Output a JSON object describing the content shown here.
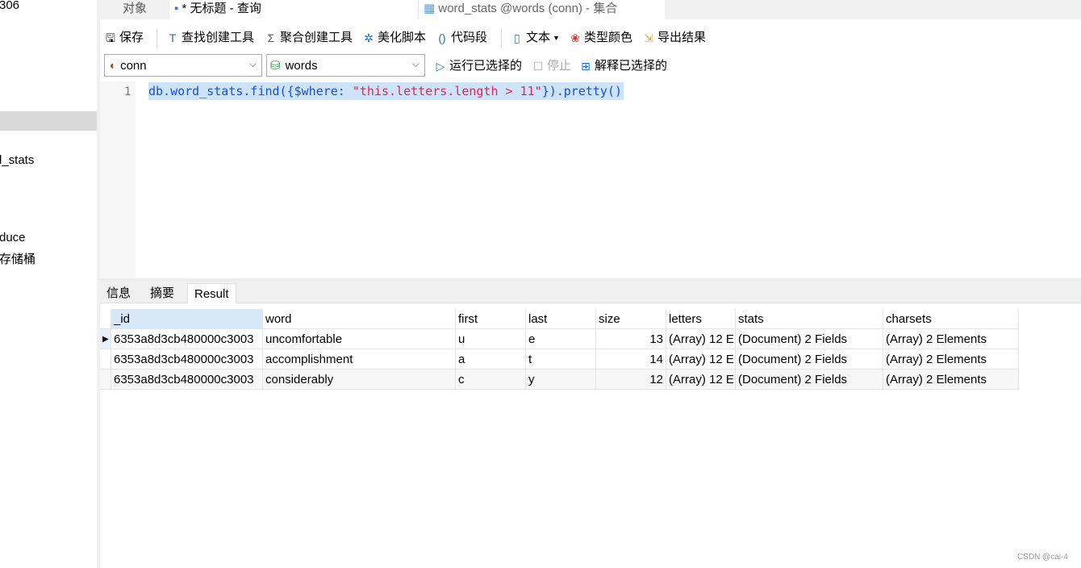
{
  "sidebar": {
    "items": [
      "306",
      "l_stats",
      "duce",
      "存储桶"
    ]
  },
  "tabs": [
    {
      "label": "对象"
    },
    {
      "label": "* 无标题 - 查询"
    },
    {
      "label": "word_stats @words (conn) - 集合"
    }
  ],
  "toolbar": {
    "save": "保存",
    "find_builder": "查找创建工具",
    "aggregate_builder": "聚合创建工具",
    "beautify": "美化脚本",
    "snippet": "代码段",
    "text": "文本",
    "type_color": "类型颜色",
    "export": "导出结果"
  },
  "query_bar": {
    "connection": "conn",
    "database": "words",
    "run_selected": "运行已选择的",
    "stop": "停止",
    "explain_selected": "解释已选择的"
  },
  "editor": {
    "line_number": "1",
    "code_parts": [
      "db.word_stats.find({$where: ",
      "\"this.letters.length > 11\"",
      "}).pretty()"
    ]
  },
  "result_tabs": [
    "信息",
    "摘要",
    "Result"
  ],
  "grid": {
    "columns": [
      "_id",
      "word",
      "first",
      "last",
      "size",
      "letters",
      "stats",
      "charsets"
    ],
    "rows": [
      [
        "6353a8d3cb480000c3003",
        "uncomfortable",
        "u",
        "e",
        "13",
        "(Array) 12 E",
        "(Document) 2 Fields",
        "(Array) 2 Elements"
      ],
      [
        "6353a8d3cb480000c3003",
        "accomplishment",
        "a",
        "t",
        "14",
        "(Array) 12 E",
        "(Document) 2 Fields",
        "(Array) 2 Elements"
      ],
      [
        "6353a8d3cb480000c3003",
        "considerably",
        "c",
        "y",
        "12",
        "(Array) 12 E",
        "(Document) 2 Fields",
        "(Array) 2 Elements"
      ]
    ]
  },
  "watermark": "CSDN @cai-4",
  "colors": {
    "keyword": "#1a4fd6",
    "string": "#e0245e",
    "selection": "#cde3f7"
  }
}
